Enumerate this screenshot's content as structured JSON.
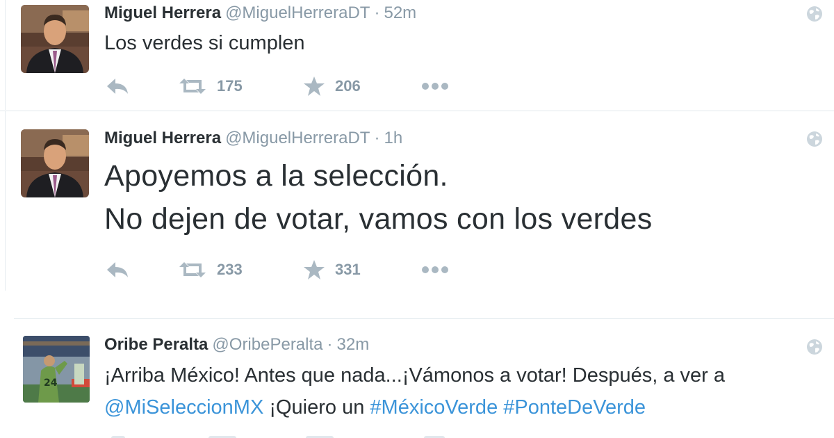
{
  "tweets": [
    {
      "name": "Miguel Herrera",
      "handle": "@MiguelHerreraDT",
      "separator": "·",
      "time": "52m",
      "text_lines": [
        "Los verdes si cumplen"
      ],
      "retweets": "175",
      "favorites": "206",
      "avatar": "suited-man-avatar"
    },
    {
      "name": "Miguel Herrera",
      "handle": "@MiguelHerreraDT",
      "separator": "·",
      "time": "1h",
      "text_lines": [
        "Apoyemos a la selección.",
        "No dejen de votar, vamos con los verdes"
      ],
      "retweets": "233",
      "favorites": "331",
      "avatar": "suited-man-avatar"
    },
    {
      "name": "Oribe Peralta",
      "handle": "@OribePeralta",
      "separator": "·",
      "time": "32m",
      "line1": "¡Arriba México! Antes que nada...¡Vámonos a votar! Después, a ver a",
      "mention": "@MiSeleccionMX",
      "line2_mid": " ¡Quiero un ",
      "hashtag1": "#MéxicoVerde",
      "hashtag2": "#PonteDeVerde",
      "avatar": "soccer-player-avatar"
    }
  ],
  "colors": {
    "link": "#3b94d9",
    "muted": "#8899a6",
    "icon": "#aab8c2",
    "text": "#292f33"
  },
  "icons": [
    "reply-icon",
    "retweet-icon",
    "favorite-star-icon",
    "more-icon",
    "globe-icon"
  ]
}
